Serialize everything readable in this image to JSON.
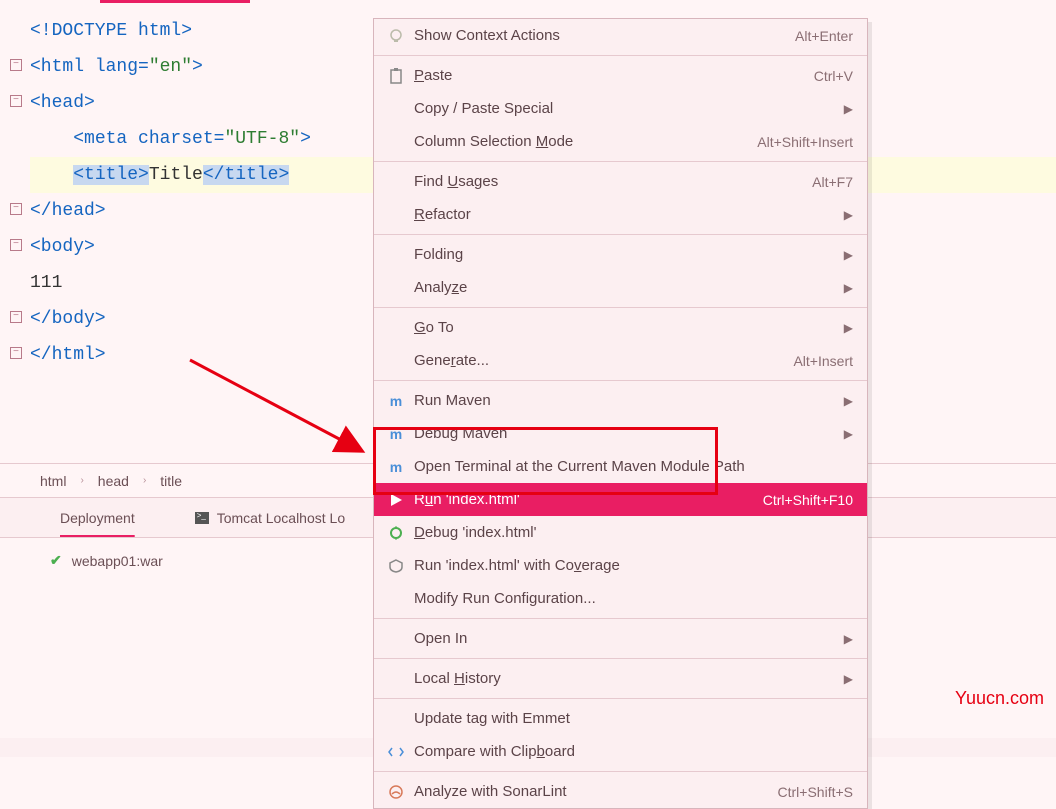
{
  "editor": {
    "lines": [
      {
        "tokens": [
          {
            "t": "tag",
            "v": "<!DOCTYPE "
          },
          {
            "t": "attr",
            "v": "html"
          },
          {
            "t": "tag",
            "v": ">"
          }
        ],
        "fold": false
      },
      {
        "tokens": [
          {
            "t": "tag",
            "v": "<html "
          },
          {
            "t": "attr",
            "v": "lang="
          },
          {
            "t": "val",
            "v": "\"en\""
          },
          {
            "t": "tag",
            "v": ">"
          }
        ],
        "fold": true
      },
      {
        "tokens": [
          {
            "t": "tag",
            "v": "<head>"
          }
        ],
        "fold": true
      },
      {
        "tokens": [
          {
            "t": "text",
            "v": "    "
          },
          {
            "t": "tag",
            "v": "<meta "
          },
          {
            "t": "attr",
            "v": "charset="
          },
          {
            "t": "val",
            "v": "\"UTF-8\""
          },
          {
            "t": "tag",
            "v": ">"
          }
        ],
        "fold": false
      },
      {
        "tokens": [
          {
            "t": "text",
            "v": "    "
          },
          {
            "t": "tag sel",
            "v": "<title>"
          },
          {
            "t": "text",
            "v": "Title"
          },
          {
            "t": "tag sel",
            "v": "</title>"
          }
        ],
        "fold": false,
        "hl": true
      },
      {
        "tokens": [
          {
            "t": "tag",
            "v": "</head>"
          }
        ],
        "fold": true
      },
      {
        "tokens": [
          {
            "t": "tag",
            "v": "<body>"
          }
        ],
        "fold": true
      },
      {
        "tokens": [
          {
            "t": "text",
            "v": "111"
          }
        ],
        "fold": false
      },
      {
        "tokens": [
          {
            "t": "tag",
            "v": "</body>"
          }
        ],
        "fold": true
      },
      {
        "tokens": [
          {
            "t": "tag",
            "v": "</html>"
          }
        ],
        "fold": true
      }
    ]
  },
  "breadcrumb": [
    "html",
    "head",
    "title"
  ],
  "bottom": {
    "tabs": [
      {
        "label": "Deployment",
        "active": true
      },
      {
        "label": "Tomcat Localhost Lo",
        "active": false
      }
    ],
    "deploy_item": "webapp01:war"
  },
  "menu": [
    {
      "type": "item",
      "icon": "bulb",
      "label": "Show Context Actions",
      "shortcut": "Alt+Enter"
    },
    {
      "type": "sep"
    },
    {
      "type": "item",
      "icon": "paste",
      "label": "<u>P</u>aste",
      "shortcut": "Ctrl+V"
    },
    {
      "type": "item",
      "icon": "",
      "label": "Copy / Paste Special",
      "sub": ">"
    },
    {
      "type": "item",
      "icon": "",
      "label": "Column Selection <u>M</u>ode",
      "shortcut": "Alt+Shift+Insert"
    },
    {
      "type": "sep"
    },
    {
      "type": "item",
      "icon": "",
      "label": "Find <u>U</u>sages",
      "shortcut": "Alt+F7"
    },
    {
      "type": "item",
      "icon": "",
      "label": "<u>R</u>efactor",
      "sub": ">"
    },
    {
      "type": "sep"
    },
    {
      "type": "item",
      "icon": "",
      "label": "Folding",
      "sub": ">"
    },
    {
      "type": "item",
      "icon": "",
      "label": "Analy<u>z</u>e",
      "sub": ">"
    },
    {
      "type": "sep"
    },
    {
      "type": "item",
      "icon": "",
      "label": "<u>G</u>o To",
      "sub": ">"
    },
    {
      "type": "item",
      "icon": "",
      "label": "Gene<u>r</u>ate...",
      "shortcut": "Alt+Insert"
    },
    {
      "type": "sep"
    },
    {
      "type": "item",
      "icon": "maven",
      "label": "Run Maven",
      "sub": ">"
    },
    {
      "type": "item",
      "icon": "maven-dbg",
      "label": "Debug Maven",
      "sub": ">"
    },
    {
      "type": "item",
      "icon": "maven-term",
      "label": "Open Terminal at the Current Maven Module Path"
    },
    {
      "type": "item",
      "icon": "run",
      "label": "R<u>u</u>n 'index.html'",
      "shortcut": "Ctrl+Shift+F10",
      "hl": true
    },
    {
      "type": "item",
      "icon": "debug",
      "label": "<u>D</u>ebug 'index.html'"
    },
    {
      "type": "item",
      "icon": "coverage",
      "label": "Run 'index.html' with Co<u>v</u>erage"
    },
    {
      "type": "item",
      "icon": "",
      "label": "Modify Run Configuration..."
    },
    {
      "type": "sep"
    },
    {
      "type": "item",
      "icon": "",
      "label": "Open In",
      "sub": ">"
    },
    {
      "type": "sep"
    },
    {
      "type": "item",
      "icon": "",
      "label": "Local <u>H</u>istory",
      "sub": ">"
    },
    {
      "type": "sep"
    },
    {
      "type": "item",
      "icon": "",
      "label": "Update tag with Emmet"
    },
    {
      "type": "item",
      "icon": "compare",
      "label": "Compare with Clip<u>b</u>oard"
    },
    {
      "type": "sep"
    },
    {
      "type": "item",
      "icon": "sonar",
      "label": "Analyze with SonarLint",
      "shortcut": "Ctrl+Shift+S"
    }
  ],
  "watermark": "Yuucn.com"
}
